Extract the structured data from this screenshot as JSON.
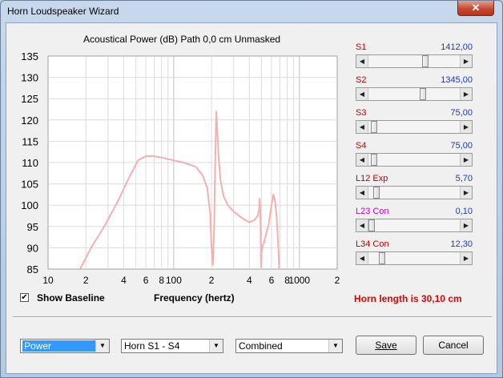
{
  "window": {
    "title": "Horn Loudspeaker Wizard",
    "close_glyph": "✕"
  },
  "chart": {
    "title": "Acoustical Power (dB)   Path 0,0 cm   Unmasked",
    "xlabel": "Frequency (hertz)"
  },
  "chart_data": {
    "type": "line",
    "title": "Acoustical Power (dB)   Path 0,0 cm   Unmasked",
    "xlabel": "Frequency (hertz)",
    "ylabel": "",
    "xscale": "log",
    "xlim": [
      10,
      2000
    ],
    "ylim": [
      85,
      135
    ],
    "x_tick_labels": [
      "10",
      "2",
      "4",
      "6",
      "8",
      "100",
      "2",
      "4",
      "6",
      "8",
      "1000",
      "2"
    ],
    "y_tick_labels": [
      "135",
      "130",
      "125",
      "120",
      "115",
      "110",
      "105",
      "100",
      "95",
      "90",
      "85"
    ],
    "y_ticks": [
      135,
      130,
      125,
      120,
      115,
      110,
      105,
      100,
      95,
      90,
      85
    ],
    "grid": true,
    "series": [
      {
        "color": "#f4b0b0",
        "x": [
          18,
          22,
          28,
          36,
          45,
          52,
          60,
          70,
          85,
          100,
          120,
          150,
          170,
          185,
          195,
          200,
          205,
          210,
          214,
          218,
          222,
          227,
          235,
          250,
          270,
          300,
          350,
          400,
          440,
          465,
          478,
          482,
          487,
          492,
          495,
          500,
          510,
          520,
          540,
          570,
          600,
          620,
          640,
          660,
          680,
          690
        ],
        "y": [
          85,
          90,
          95,
          101,
          107,
          110.5,
          111.5,
          111.5,
          111,
          110.5,
          110,
          109,
          107,
          104,
          98,
          90,
          86,
          95,
          110,
          122,
          118,
          112,
          106,
          102,
          100,
          98.5,
          97,
          96,
          96.5,
          97.5,
          99,
          101.5,
          100,
          95,
          85.5,
          89,
          90.5,
          91,
          93,
          95.5,
          100,
          102.5,
          101,
          97,
          90,
          85
        ]
      }
    ]
  },
  "baseline": {
    "label": "Show Baseline",
    "checked": true,
    "check_glyph": "✔"
  },
  "sliders": [
    {
      "label": "S1",
      "value": "1412,00",
      "label_color": "#c00000",
      "thumb_fraction": 0.62
    },
    {
      "label": "S2",
      "value": "1345,00",
      "label_color": "#c00000",
      "thumb_fraction": 0.59
    },
    {
      "label": "S3",
      "value": "75,00",
      "label_color": "#c00000",
      "thumb_fraction": 0.03
    },
    {
      "label": "S4",
      "value": "75,00",
      "label_color": "#c00000",
      "thumb_fraction": 0.03
    },
    {
      "label": "L12  Exp",
      "value": "5,70",
      "label_color": "#c00000",
      "thumb_fraction": 0.06
    },
    {
      "label": "L23  Con",
      "value": "0,10",
      "label_color": "#cc00cc",
      "thumb_fraction": 0.0
    },
    {
      "label": "L34  Con",
      "value": "12,30",
      "label_color": "#c00000",
      "thumb_fraction": 0.12
    }
  ],
  "horn_length": "Horn length is 30,10 cm",
  "controls": {
    "mode_select": "Power",
    "horn_select": "Horn S1 - S4",
    "combine_select": "Combined",
    "save_label": "Save",
    "cancel_label": "Cancel"
  },
  "colors": {
    "curve": "#f4b0b0",
    "value_blue": "#1f3aa8",
    "label_red": "#c00000",
    "horn_length_red": "#e00000"
  }
}
